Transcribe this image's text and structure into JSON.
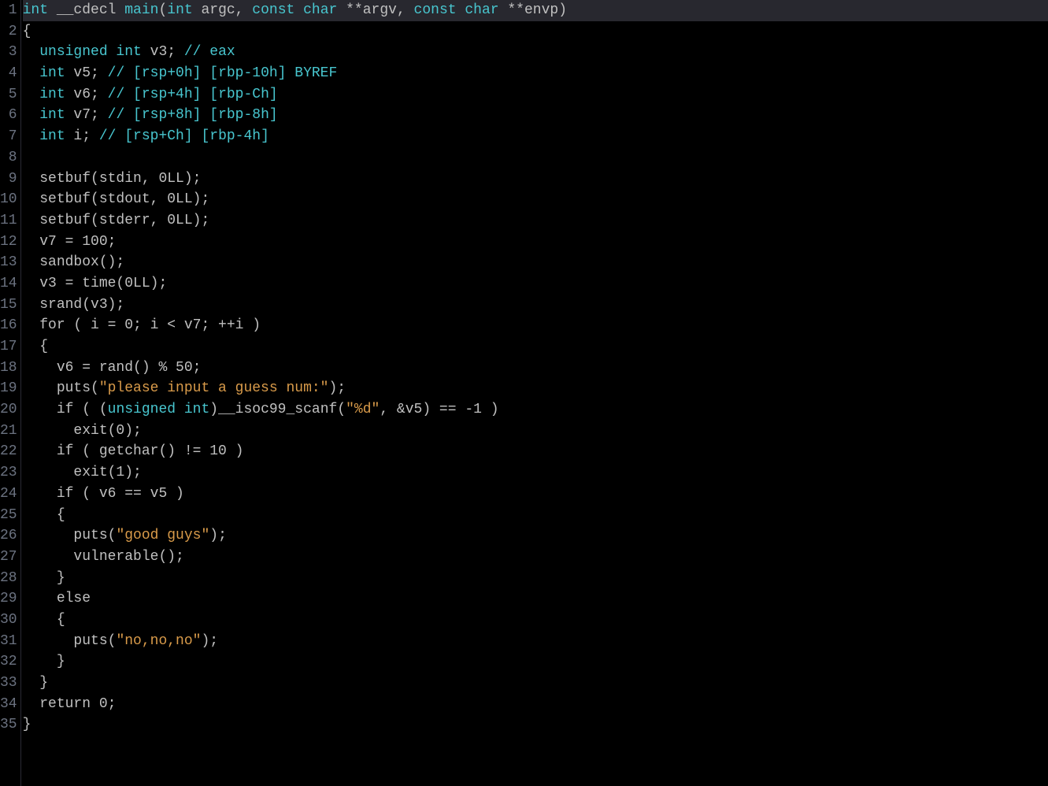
{
  "lines": [
    {
      "n": 1,
      "hl": true,
      "tokens": [
        {
          "c": "type",
          "t": "int"
        },
        {
          "c": "id",
          "t": " __cdecl "
        },
        {
          "c": "type",
          "t": "main"
        },
        {
          "c": "paren",
          "t": "("
        },
        {
          "c": "type",
          "t": "int"
        },
        {
          "c": "id",
          "t": " argc, "
        },
        {
          "c": "type",
          "t": "const char"
        },
        {
          "c": "id",
          "t": " **argv, "
        },
        {
          "c": "type",
          "t": "const char"
        },
        {
          "c": "id",
          "t": " **envp)"
        }
      ]
    },
    {
      "n": 2,
      "tokens": [
        {
          "c": "id",
          "t": "{"
        }
      ]
    },
    {
      "n": 3,
      "tokens": [
        {
          "c": "id",
          "t": "  "
        },
        {
          "c": "type",
          "t": "unsigned int"
        },
        {
          "c": "id",
          "t": " v3; "
        },
        {
          "c": "cmt",
          "t": "// eax"
        }
      ]
    },
    {
      "n": 4,
      "tokens": [
        {
          "c": "id",
          "t": "  "
        },
        {
          "c": "type",
          "t": "int"
        },
        {
          "c": "id",
          "t": " v5; "
        },
        {
          "c": "cmt",
          "t": "// [rsp+0h] [rbp-10h] BYREF"
        }
      ]
    },
    {
      "n": 5,
      "tokens": [
        {
          "c": "id",
          "t": "  "
        },
        {
          "c": "type",
          "t": "int"
        },
        {
          "c": "id",
          "t": " v6; "
        },
        {
          "c": "cmt",
          "t": "// [rsp+4h] [rbp-Ch]"
        }
      ]
    },
    {
      "n": 6,
      "tokens": [
        {
          "c": "id",
          "t": "  "
        },
        {
          "c": "type",
          "t": "int"
        },
        {
          "c": "id",
          "t": " v7; "
        },
        {
          "c": "cmt",
          "t": "// [rsp+8h] [rbp-8h]"
        }
      ]
    },
    {
      "n": 7,
      "tokens": [
        {
          "c": "id",
          "t": "  "
        },
        {
          "c": "type",
          "t": "int"
        },
        {
          "c": "id",
          "t": " i; "
        },
        {
          "c": "cmt",
          "t": "// [rsp+Ch] [rbp-4h]"
        }
      ]
    },
    {
      "n": 8,
      "tokens": [
        {
          "c": "id",
          "t": ""
        }
      ]
    },
    {
      "n": 9,
      "tokens": [
        {
          "c": "id",
          "t": "  setbuf(stdin, 0LL);"
        }
      ]
    },
    {
      "n": 10,
      "tokens": [
        {
          "c": "id",
          "t": "  setbuf(stdout, 0LL);"
        }
      ]
    },
    {
      "n": 11,
      "tokens": [
        {
          "c": "id",
          "t": "  setbuf(stderr, 0LL);"
        }
      ]
    },
    {
      "n": 12,
      "tokens": [
        {
          "c": "id",
          "t": "  v7 = 100;"
        }
      ]
    },
    {
      "n": 13,
      "tokens": [
        {
          "c": "id",
          "t": "  sandbox();"
        }
      ]
    },
    {
      "n": 14,
      "tokens": [
        {
          "c": "id",
          "t": "  v3 = time(0LL);"
        }
      ]
    },
    {
      "n": 15,
      "tokens": [
        {
          "c": "id",
          "t": "  srand(v3);"
        }
      ]
    },
    {
      "n": 16,
      "tokens": [
        {
          "c": "id",
          "t": "  for ( i = 0; i < v7; ++i )"
        }
      ]
    },
    {
      "n": 17,
      "tokens": [
        {
          "c": "id",
          "t": "  {"
        }
      ]
    },
    {
      "n": 18,
      "tokens": [
        {
          "c": "id",
          "t": "    v6 = rand() % 50;"
        }
      ]
    },
    {
      "n": 19,
      "tokens": [
        {
          "c": "id",
          "t": "    puts("
        },
        {
          "c": "str",
          "t": "\"please input a guess num:\""
        },
        {
          "c": "id",
          "t": ");"
        }
      ]
    },
    {
      "n": 20,
      "tokens": [
        {
          "c": "id",
          "t": "    if ( ("
        },
        {
          "c": "type",
          "t": "unsigned int"
        },
        {
          "c": "id",
          "t": ")__isoc99_scanf("
        },
        {
          "c": "str",
          "t": "\"%d\""
        },
        {
          "c": "id",
          "t": ", &v5) == -1 )"
        }
      ]
    },
    {
      "n": 21,
      "tokens": [
        {
          "c": "id",
          "t": "      exit(0);"
        }
      ]
    },
    {
      "n": 22,
      "tokens": [
        {
          "c": "id",
          "t": "    if ( getchar() != 10 )"
        }
      ]
    },
    {
      "n": 23,
      "tokens": [
        {
          "c": "id",
          "t": "      exit(1);"
        }
      ]
    },
    {
      "n": 24,
      "tokens": [
        {
          "c": "id",
          "t": "    if ( v6 == v5 )"
        }
      ]
    },
    {
      "n": 25,
      "tokens": [
        {
          "c": "id",
          "t": "    {"
        }
      ]
    },
    {
      "n": 26,
      "tokens": [
        {
          "c": "id",
          "t": "      puts("
        },
        {
          "c": "str",
          "t": "\"good guys\""
        },
        {
          "c": "id",
          "t": ");"
        }
      ]
    },
    {
      "n": 27,
      "tokens": [
        {
          "c": "id",
          "t": "      vulnerable();"
        }
      ]
    },
    {
      "n": 28,
      "tokens": [
        {
          "c": "id",
          "t": "    }"
        }
      ]
    },
    {
      "n": 29,
      "tokens": [
        {
          "c": "id",
          "t": "    else"
        }
      ]
    },
    {
      "n": 30,
      "tokens": [
        {
          "c": "id",
          "t": "    {"
        }
      ]
    },
    {
      "n": 31,
      "tokens": [
        {
          "c": "id",
          "t": "      puts("
        },
        {
          "c": "str",
          "t": "\"no,no,no\""
        },
        {
          "c": "id",
          "t": ");"
        }
      ]
    },
    {
      "n": 32,
      "tokens": [
        {
          "c": "id",
          "t": "    }"
        }
      ]
    },
    {
      "n": 33,
      "tokens": [
        {
          "c": "id",
          "t": "  }"
        }
      ]
    },
    {
      "n": 34,
      "tokens": [
        {
          "c": "id",
          "t": "  return 0;"
        }
      ]
    },
    {
      "n": 35,
      "tokens": [
        {
          "c": "id",
          "t": "}"
        }
      ]
    }
  ]
}
